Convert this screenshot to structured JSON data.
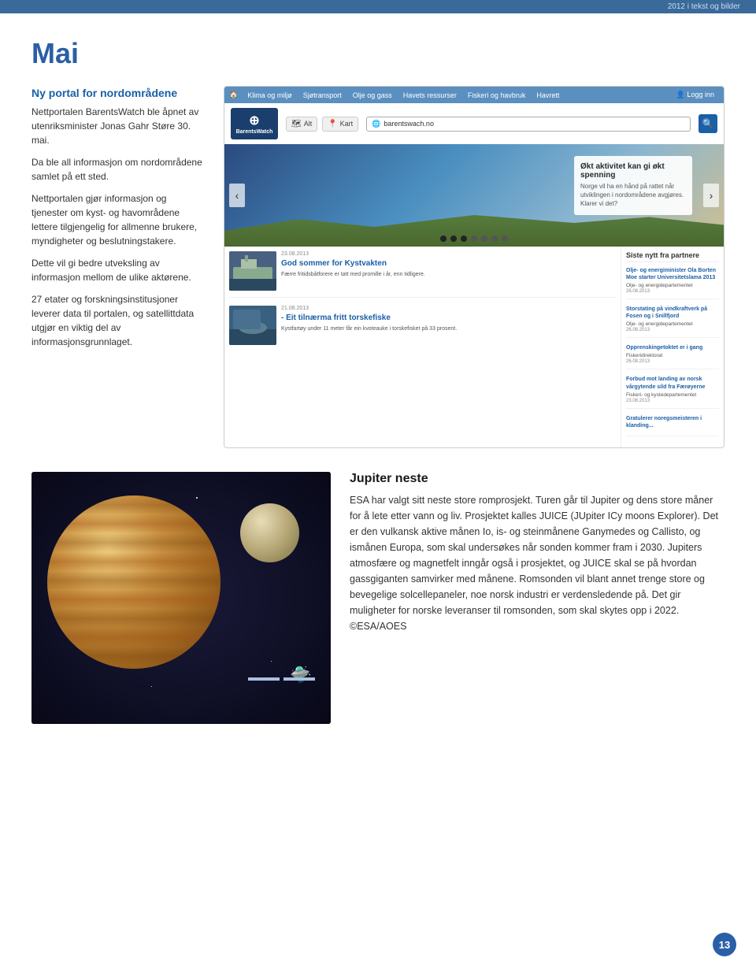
{
  "header": {
    "top_text": "2012 i tekst og bilder"
  },
  "page": {
    "title": "Mai",
    "number": "13"
  },
  "left_column": {
    "heading": "Ny portal for nordområdene",
    "paragraphs": [
      "Nettportalen BarentsWatch ble åpnet av utenriksminister Jonas Gahr Støre 30. mai.",
      "Da ble all informasjon om nordområdene samlet på ett sted.",
      "Nettportalen gjør informasjon og tjenester om kyst- og havområdene lettere tilgjengelig for allmenne brukere, myndigheter og beslutningstakere.",
      "Dette vil gi bedre utveksling av informasjon mellom de ulike aktørene.",
      "27 etater og forskningsinstitusjoner leverer data til portalen, og satellittdata utgjør en viktig del av informasjonsgrunnlaget."
    ]
  },
  "browser": {
    "site_name": "BarentsWatch",
    "url": "barentswach.no",
    "nav_tabs": [
      {
        "label": "Klima og miljø",
        "active": false
      },
      {
        "label": "Sjøtransport",
        "active": false
      },
      {
        "label": "Olje og gass",
        "active": false
      },
      {
        "label": "Havets ressurser",
        "active": false
      },
      {
        "label": "Fiskeri og havbruk",
        "active": false
      },
      {
        "label": "Havrett",
        "active": false
      },
      {
        "label": "Logg inn",
        "active": false
      }
    ],
    "view_tabs": [
      {
        "icon": "🗺",
        "label": "Alt"
      },
      {
        "icon": "📍",
        "label": "Kart"
      }
    ],
    "hero": {
      "info_title": "Økt aktivitet kan gi økt spenning",
      "info_text": "Norge vil ha en hånd på rattet når utviklingen i nordområdene avgjøres. Klarer vi det?",
      "dots": 7,
      "active_dot": 3
    },
    "news_items": [
      {
        "date": "23.08.2013",
        "title": "God sommer for Kystvakten",
        "excerpt": "Færre fristidsbåtforere er tatt med promille i år, enn tidligere.",
        "thumb_type": "ship"
      },
      {
        "date": "21.08.2013",
        "title": "- Eit tilnærma fritt torskefiske",
        "excerpt": "Kystfartøy under 11 meter får ein kvoteauke i torskefisket på 33 prosent.",
        "thumb_type": "fish"
      }
    ],
    "partners": {
      "heading": "Siste nytt fra partnere",
      "items": [
        {
          "title": "Olje- og energiminister Ola Borten Moe starter Universitetslama 2013",
          "org": "Olje- og energidepartementet",
          "date": "26.08.2013"
        },
        {
          "title": "Storstating på vindkraftverk på Fosen og i Snillfjord",
          "org": "Olje- og energidepartementet",
          "date": "26.08.2013"
        },
        {
          "title": "Opprenskingetoktet er i gang",
          "org": "Fiskeridirektorast",
          "date": "26.08.2013"
        },
        {
          "title": "Forbud mot landing av norsk vårgytende sild fra Færøyerne",
          "org": "Fiskeri- og kystedepartementet",
          "date": "23.08.2013"
        },
        {
          "title": "Gratulerer noregsmeisteren i",
          "org": "klanding...",
          "date": ""
        }
      ]
    }
  },
  "jupiter": {
    "heading": "Jupiter neste",
    "body": "ESA har valgt sitt neste store romprosjekt. Turen går til Jupiter og dens store måner for å lete etter vann og liv. Prosjektet kalles JUICE (JUpiter ICy moons Explorer). Det er den vulkansk aktive månen Io, is- og steinmånene Ganymedes og Callisto, og ismånen Europa, som skal undersøkes når sonden kommer fram i 2030. Jupiters atmosfære og magnetfelt inngår også i prosjektet, og JUICE skal se på hvordan gassgiganten samvirker med månene. Romsonden vil blant annet trenge store og bevegelige solcellepaneler, noe norsk industri er verdensledende på. Det gir muligheter for norske leveranser til romsonden, som skal skytes opp i 2022. ©ESA/AOES"
  }
}
